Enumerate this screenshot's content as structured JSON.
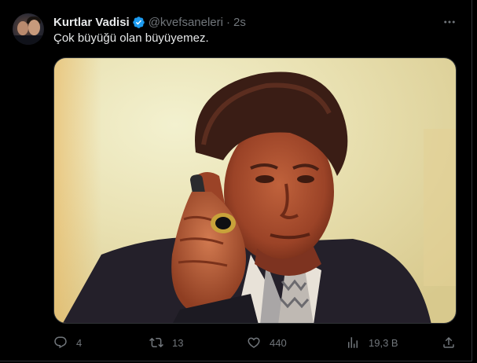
{
  "tweet": {
    "author_name": "Kurtlar Vadisi",
    "handle": "@kvefsaneleri",
    "separator": "·",
    "timestamp": "2s",
    "verified_icon": "verified-badge-icon",
    "text": "Çok büyüğü olan büyüyemez."
  },
  "actions": {
    "replies": "4",
    "retweets": "13",
    "likes": "440",
    "views": "19,3 B"
  },
  "colors": {
    "background": "#000000",
    "text_primary": "#e7e9ea",
    "text_secondary": "#71767b",
    "verified": "#1d9bf0",
    "border": "#2f3336"
  }
}
